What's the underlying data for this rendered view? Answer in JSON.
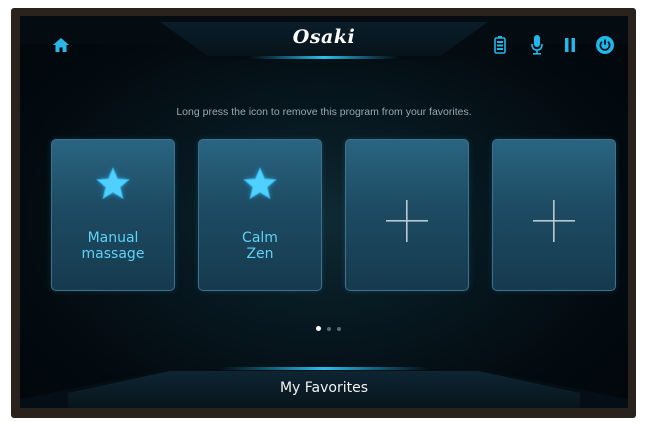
{
  "header": {
    "brand": "Osaki",
    "icons": [
      "home-icon",
      "battery-icon",
      "microphone-icon",
      "pause-icon",
      "power-icon"
    ]
  },
  "hint": "Long press the icon to remove this program from your favorites.",
  "favorites": [
    {
      "label_line1": "Manual",
      "label_line2": "massage",
      "icon": "star-icon",
      "empty": false
    },
    {
      "label_line1": "Calm",
      "label_line2": "Zen",
      "icon": "star-icon",
      "empty": false
    },
    {
      "icon": "plus-icon",
      "empty": true
    },
    {
      "icon": "plus-icon",
      "empty": true
    }
  ],
  "pagination": {
    "pages": 3,
    "current": 1
  },
  "footer": {
    "title": "My Favorites"
  },
  "colors": {
    "accent": "#2ab7e8",
    "label": "#5fd2f5",
    "card": "#1d4b63"
  }
}
